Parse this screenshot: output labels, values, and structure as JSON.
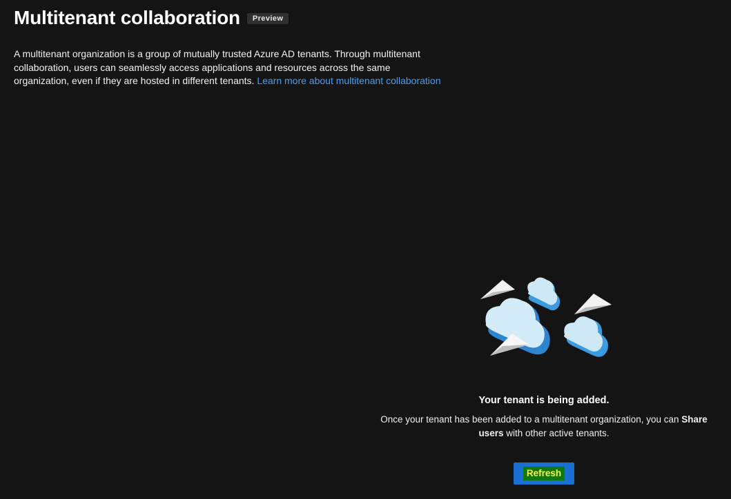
{
  "header": {
    "title": "Multitenant collaboration",
    "badge": "Preview"
  },
  "description": {
    "text": "A multitenant organization is a group of mutually trusted Azure AD tenants. Through multitenant collaboration, users can seamlessly access applications and resources across the same organization, even if they are hosted in different tenants. ",
    "link": "Learn more about multitenant collaboration"
  },
  "empty_state": {
    "illustration": "clouds-paper-planes-illustration",
    "title": "Your tenant is being added.",
    "body_pre": "Once your tenant has been added to a multitenant organization, you can ",
    "body_bold": "Share users",
    "body_post": " with other active tenants.",
    "refresh_label": "Refresh"
  },
  "colors": {
    "background": "#141414",
    "link": "#479ef5",
    "primary_button": "#1a6fd2",
    "badge_bg": "#2f2f2f",
    "cloud_light": "#cfe8f5",
    "cloud_side": "#3a9be0"
  }
}
